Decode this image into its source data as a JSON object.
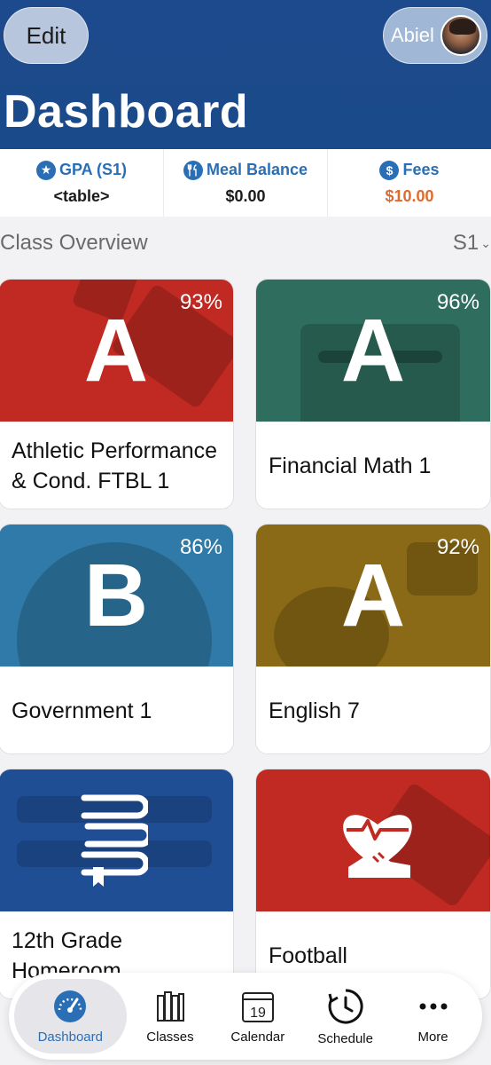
{
  "header": {
    "edit_label": "Edit",
    "profile_name": "Abiel",
    "title": "Dashboard",
    "color": "#1c4a8c"
  },
  "summary": [
    {
      "label": "GPA (S1)",
      "icon": "star-icon",
      "value": "<table>"
    },
    {
      "label": "Meal Balance",
      "icon": "utensils-icon",
      "value": "$0.00"
    },
    {
      "label": "Fees",
      "icon": "dollar-icon",
      "value": "$10.00",
      "value_color": "#e06a2e"
    }
  ],
  "overview": {
    "title": "Class Overview",
    "term": "S1"
  },
  "classes": [
    {
      "name": "Athletic Performance & Cond. FTBL 1",
      "grade": "A",
      "percent": "93%",
      "color": "#c02a22",
      "icon": "athletics-icon"
    },
    {
      "name": "Financial Math 1",
      "grade": "A",
      "percent": "96%",
      "color": "#2f6e5e",
      "icon": "calculator-icon"
    },
    {
      "name": "Government 1",
      "grade": "B",
      "percent": "86%",
      "color": "#2f7aa8",
      "icon": "globe-icon"
    },
    {
      "name": "English 7",
      "grade": "A",
      "percent": "92%",
      "color": "#8a6a16",
      "icon": "apple-icon"
    },
    {
      "name": "12th Grade Homeroom",
      "grade": "",
      "percent": "",
      "color": "#1f4e94",
      "icon": "books-icon"
    },
    {
      "name": "Football",
      "grade": "",
      "percent": "",
      "color": "#c02a22",
      "icon": "heart-shoe-icon"
    }
  ],
  "tabs": [
    {
      "label": "Dashboard",
      "icon": "speedometer-icon",
      "active": true
    },
    {
      "label": "Classes",
      "icon": "books-icon"
    },
    {
      "label": "Calendar",
      "icon": "calendar-icon",
      "day": "19"
    },
    {
      "label": "Schedule",
      "icon": "clock-icon"
    },
    {
      "label": "More",
      "icon": "more-icon"
    }
  ]
}
